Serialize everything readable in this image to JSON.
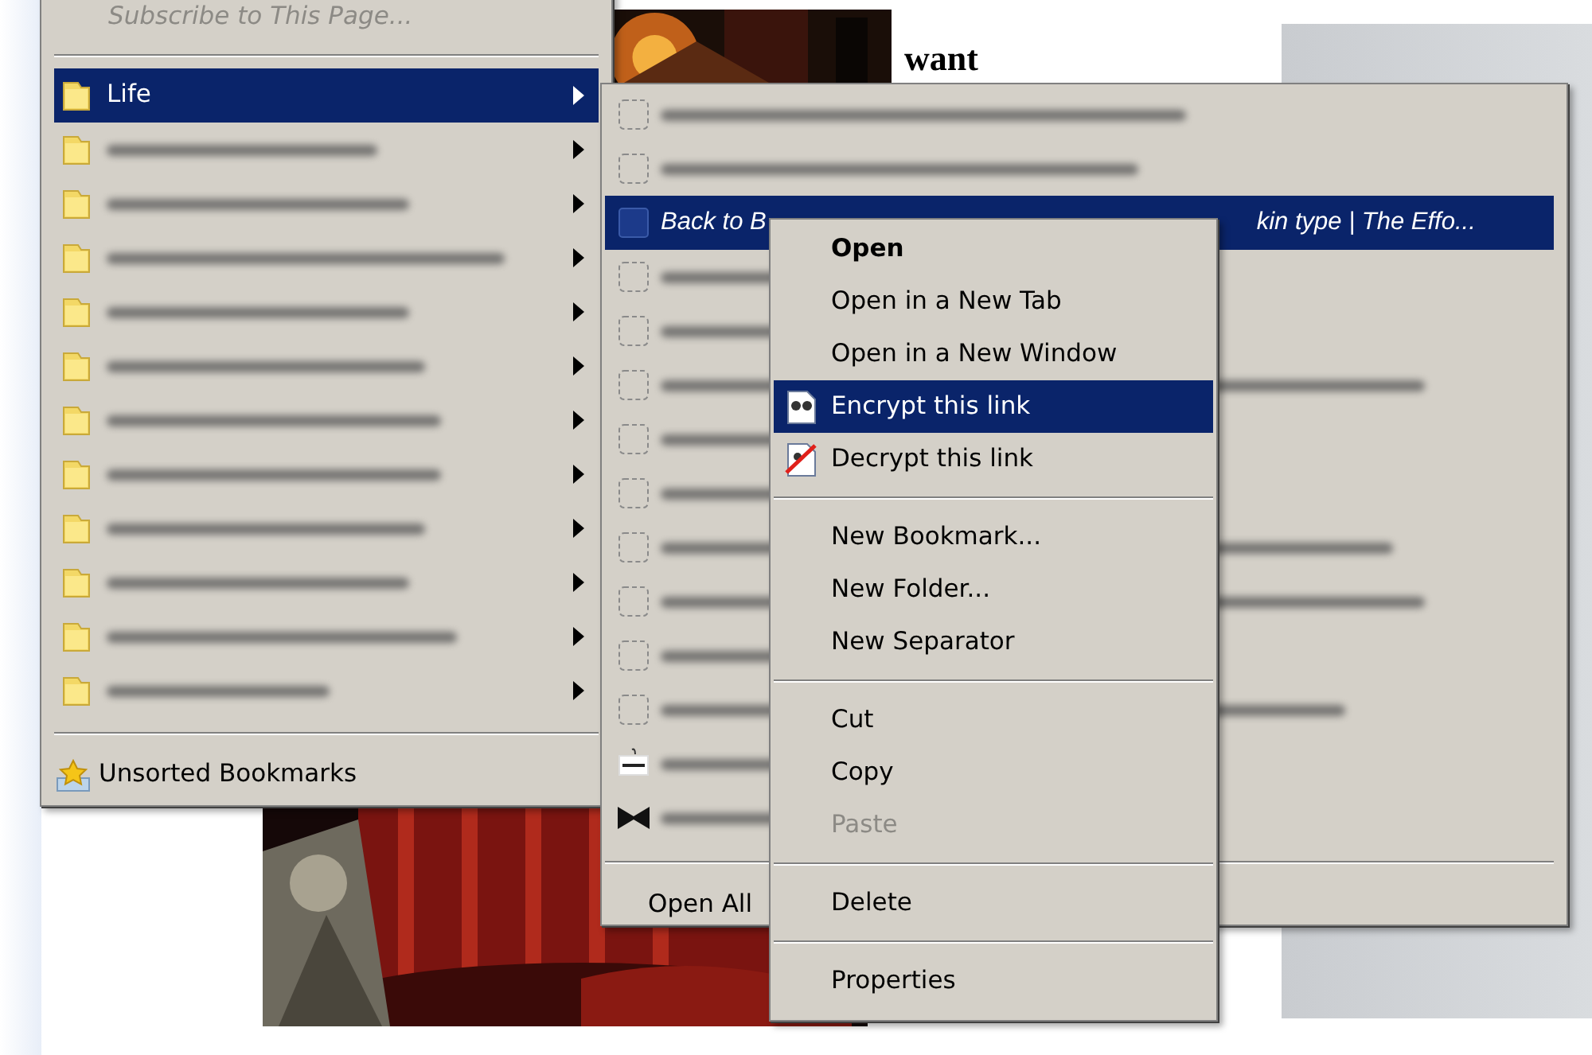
{
  "background": {
    "text": "want"
  },
  "bookmarks_menu": {
    "items": [
      {
        "kind": "action",
        "label": "Subscribe to This Page...",
        "disabled": true
      },
      {
        "kind": "separator"
      },
      {
        "kind": "folder",
        "label": "Life",
        "selected": true
      },
      {
        "kind": "blurred_folder",
        "selected": false
      },
      {
        "kind": "blurred_folder",
        "selected": false
      },
      {
        "kind": "blurred_folder",
        "selected": false
      },
      {
        "kind": "blurred_folder",
        "selected": false
      },
      {
        "kind": "blurred_folder",
        "selected": false
      },
      {
        "kind": "blurred_folder",
        "selected": false
      },
      {
        "kind": "blurred_folder",
        "selected": false
      },
      {
        "kind": "blurred_folder",
        "selected": false
      },
      {
        "kind": "blurred_folder",
        "selected": false
      },
      {
        "kind": "blurred_folder",
        "selected": false
      },
      {
        "kind": "blurred_folder",
        "selected": false
      },
      {
        "kind": "separator"
      },
      {
        "kind": "unsorted",
        "label": "Unsorted Bookmarks"
      }
    ]
  },
  "life_submenu": {
    "items": [
      {
        "kind": "blurred_long",
        "selected": false
      },
      {
        "kind": "blurred_long",
        "selected": false
      },
      {
        "kind": "bookmark",
        "label_start": "Back to B",
        "label_end": "kin type | The Effo...",
        "selected": true
      },
      {
        "kind": "blurred",
        "selected": false
      },
      {
        "kind": "blurred",
        "selected": false
      },
      {
        "kind": "blurred_long",
        "selected": false
      },
      {
        "kind": "blurred",
        "selected": false
      },
      {
        "kind": "blurred",
        "selected": false
      },
      {
        "kind": "blurred_long",
        "selected": false
      },
      {
        "kind": "blurred_long",
        "selected": false
      },
      {
        "kind": "blurred",
        "selected": false
      },
      {
        "kind": "blurred_long",
        "selected": false
      },
      {
        "kind": "blurred_tag",
        "selected": false
      },
      {
        "kind": "blurred_bowtie",
        "selected": false
      },
      {
        "kind": "separator"
      },
      {
        "kind": "action",
        "label": "Open All",
        "selected": false
      }
    ]
  },
  "context_menu": {
    "items": [
      {
        "kind": "item",
        "label": "Open",
        "bold": true,
        "disabled": false,
        "selected": false
      },
      {
        "kind": "item",
        "label": "Open in a New Tab",
        "bold": false,
        "disabled": false,
        "selected": false
      },
      {
        "kind": "item",
        "label": "Open in a New Window",
        "bold": false,
        "disabled": false,
        "selected": false
      },
      {
        "kind": "encrypt_item",
        "label": "Encrypt this link",
        "bold": false,
        "disabled": false,
        "selected": true
      },
      {
        "kind": "decrypt_item",
        "label": "Decrypt this link",
        "bold": false,
        "disabled": false,
        "selected": false
      },
      {
        "kind": "separator"
      },
      {
        "kind": "item",
        "label": "New Bookmark...",
        "bold": false,
        "disabled": false,
        "selected": false
      },
      {
        "kind": "item",
        "label": "New Folder...",
        "bold": false,
        "disabled": false,
        "selected": false
      },
      {
        "kind": "item",
        "label": "New Separator",
        "bold": false,
        "disabled": false,
        "selected": false
      },
      {
        "kind": "separator"
      },
      {
        "kind": "item",
        "label": "Cut",
        "bold": false,
        "disabled": false,
        "selected": false
      },
      {
        "kind": "item",
        "label": "Copy",
        "bold": false,
        "disabled": false,
        "selected": false
      },
      {
        "kind": "item",
        "label": "Paste",
        "bold": false,
        "disabled": true,
        "selected": false
      },
      {
        "kind": "separator"
      },
      {
        "kind": "item",
        "label": "Delete",
        "bold": false,
        "disabled": false,
        "selected": false
      },
      {
        "kind": "separator"
      },
      {
        "kind": "item",
        "label": "Properties",
        "bold": false,
        "disabled": false,
        "selected": false
      }
    ]
  }
}
